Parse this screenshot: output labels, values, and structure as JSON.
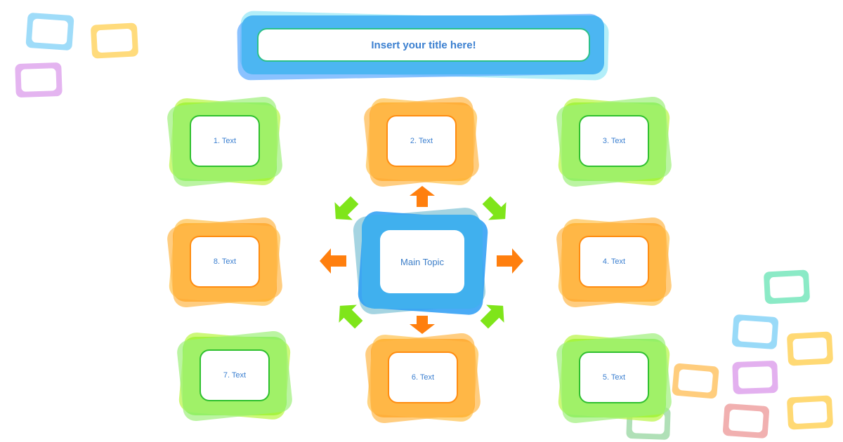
{
  "title": {
    "text": "Insert your title here!"
  },
  "center": {
    "label": "Main Topic"
  },
  "nodes": [
    {
      "label": "1. Text",
      "color": "green"
    },
    {
      "label": "2. Text",
      "color": "orange"
    },
    {
      "label": "3. Text",
      "color": "green"
    },
    {
      "label": "4. Text",
      "color": "orange"
    },
    {
      "label": "5. Text",
      "color": "green"
    },
    {
      "label": "6. Text",
      "color": "orange"
    },
    {
      "label": "7. Text",
      "color": "green"
    },
    {
      "label": "8. Text",
      "color": "orange"
    }
  ],
  "colors": {
    "blue": "#4ab3f0",
    "green": "#7ef03a",
    "orange": "#ff9a1a",
    "text": "#3b7fd0",
    "arrow_orange": "#ff7f0e",
    "arrow_green": "#7fe51a"
  }
}
